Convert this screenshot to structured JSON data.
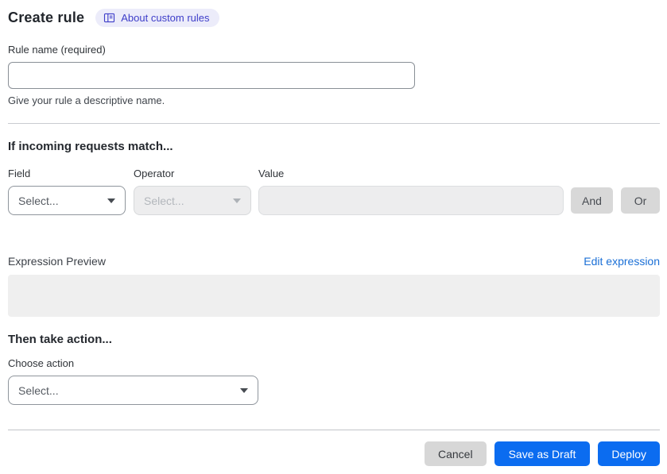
{
  "page": {
    "title": "Create rule",
    "about_badge_label": "About custom rules"
  },
  "rule_name": {
    "label": "Rule name (required)",
    "value": "",
    "placeholder": "",
    "helper": "Give your rule a descriptive name."
  },
  "match_section": {
    "heading": "If incoming requests match...",
    "field": {
      "label": "Field",
      "selected": "Select..."
    },
    "operator": {
      "label": "Operator",
      "selected": "Select..."
    },
    "value": {
      "label": "Value",
      "value": "",
      "placeholder": ""
    },
    "and_label": "And",
    "or_label": "Or"
  },
  "expression": {
    "label": "Expression Preview",
    "edit_link": "Edit expression",
    "preview": ""
  },
  "action_section": {
    "heading": "Then take action...",
    "choose_label": "Choose action",
    "selected": "Select..."
  },
  "footer": {
    "cancel": "Cancel",
    "save_draft": "Save as Draft",
    "deploy": "Deploy"
  },
  "colors": {
    "primary_blue": "#0b6cf0",
    "link_blue": "#1a6fd6",
    "badge_bg": "#ececfa",
    "badge_text": "#3e3ec9",
    "secondary_button_gray": "#d8d8d8",
    "disabled_control_bg": "#ededee",
    "preview_box_bg": "#efefef"
  }
}
